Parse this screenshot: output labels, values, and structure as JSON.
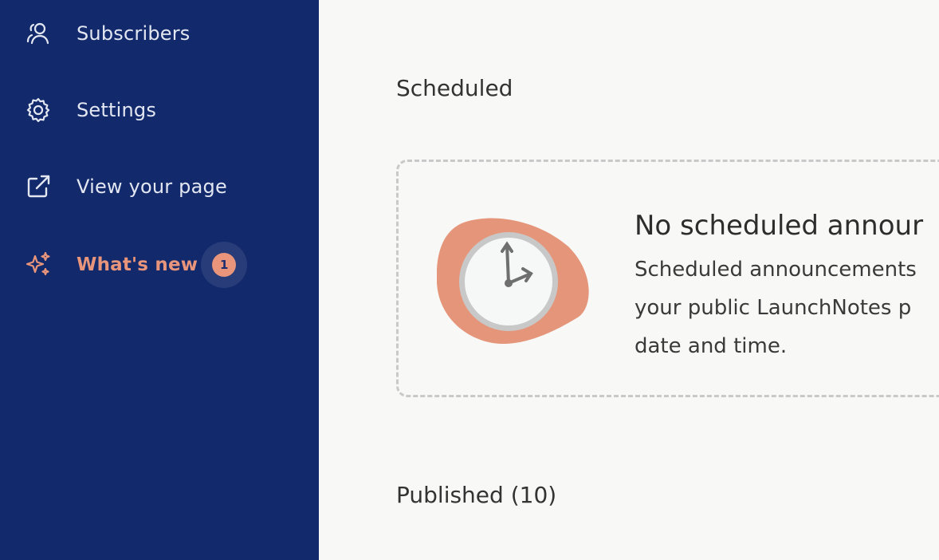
{
  "sidebar": {
    "items": [
      {
        "label": "Subscribers",
        "icon": "users-icon"
      },
      {
        "label": "Settings",
        "icon": "gear-icon"
      },
      {
        "label": "View your page",
        "icon": "external-link-icon"
      },
      {
        "label": "What's new",
        "icon": "sparkles-icon",
        "badge": "1"
      }
    ],
    "accent": "#e8957b",
    "background": "#12296b"
  },
  "main": {
    "scheduled_title": "Scheduled",
    "empty_state": {
      "heading": "No scheduled annour",
      "line1": "Scheduled announcements",
      "line2": "your public LaunchNotes p",
      "line3": "date and time."
    },
    "published_title": "Published (10)"
  }
}
